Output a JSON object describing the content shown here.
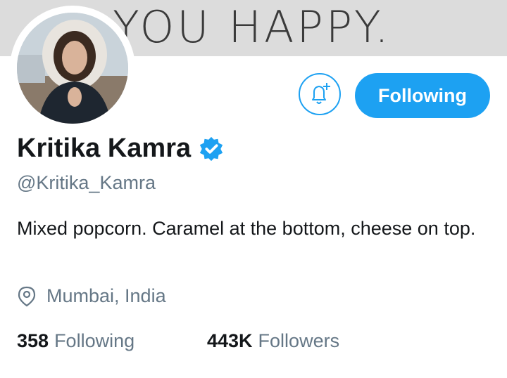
{
  "banner": {
    "text": "YOU HAPPY."
  },
  "profile": {
    "name": "Kritika Kamra",
    "verified": true,
    "handle": "@Kritika_Kamra",
    "bio": "Mixed popcorn. Caramel at the bottom, cheese on top.",
    "location": "Mumbai, India"
  },
  "actions": {
    "follow_label": "Following",
    "bell_icon": "bell-plus-icon"
  },
  "stats": {
    "following_count": "358",
    "following_label": "Following",
    "followers_count": "443K",
    "followers_label": "Followers"
  },
  "colors": {
    "accent": "#1da1f2",
    "text_primary": "#14171a",
    "text_secondary": "#657786",
    "banner_bg": "#dcdcdc"
  }
}
